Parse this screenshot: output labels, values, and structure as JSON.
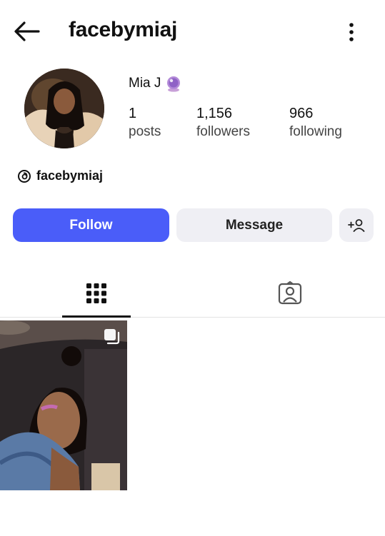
{
  "header": {
    "username": "facebymiaj"
  },
  "profile": {
    "display_name": "Mia J",
    "badge_icon": "crystal-ball-emoji",
    "stats": [
      {
        "value": "1",
        "label": "posts"
      },
      {
        "value": "1,156",
        "label": "followers"
      },
      {
        "value": "966",
        "label": "following"
      }
    ],
    "threads_handle": "facebymiaj"
  },
  "actions": {
    "follow_label": "Follow",
    "message_label": "Message",
    "suggest_icon": "add-person-icon"
  },
  "tabs": [
    {
      "name": "posts-grid",
      "icon": "grid-icon",
      "active": true
    },
    {
      "name": "tagged",
      "icon": "tagged-person-icon",
      "active": false
    }
  ],
  "posts": [
    {
      "type": "carousel",
      "icon": "multiple-posts-icon"
    }
  ],
  "colors": {
    "accent": "#4a5df9",
    "secondary_button": "#efeff4"
  }
}
